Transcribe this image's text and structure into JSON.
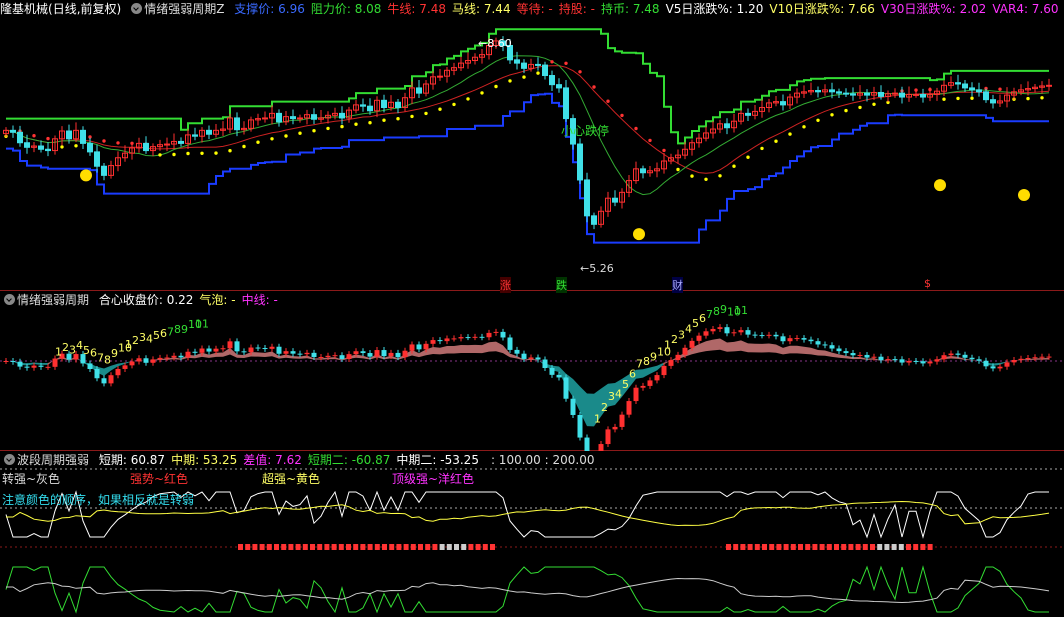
{
  "colors": {
    "bg": "#000000",
    "up": "#ff3030",
    "down": "#40e0e8",
    "green": "#33dd33",
    "blue": "#1a3cff",
    "yellow": "#ffff00",
    "magenta": "#ff33ff",
    "white": "#ffffff",
    "red": "#ff3333",
    "label_gray": "#dddddd",
    "teal": "#1a8a8a",
    "rose": "#b06868"
  },
  "panel1": {
    "stock_name": "隆基机械",
    "period": "(日线,前复权)",
    "indicator": "情绪强弱周期Z",
    "values": [
      {
        "label": "支撑价",
        "value": "6.96",
        "color": "#3a6aff"
      },
      {
        "label": "阻力价",
        "value": "8.08",
        "color": "#33dd33"
      },
      {
        "label": "牛线",
        "value": "7.48",
        "color": "#ff3333"
      },
      {
        "label": "马线",
        "value": "7.44",
        "color": "#ffff66"
      },
      {
        "label": "等待",
        "value": "-",
        "color": "#ff3333"
      },
      {
        "label": "持股",
        "value": "-",
        "color": "#ff3333"
      },
      {
        "label": "持币",
        "value": "7.48",
        "color": "#33dd33"
      },
      {
        "label": "V5日涨跌%",
        "value": "1.20",
        "color": "#ffffff"
      },
      {
        "label": "V10日涨跌%",
        "value": "7.66",
        "color": "#ffff66"
      },
      {
        "label": "V30日涨跌%",
        "value": "2.02",
        "color": "#ff33ff"
      },
      {
        "label": "VAR4",
        "value": "7.60",
        "color": "#ff33ff"
      }
    ],
    "high_label": "8.60",
    "low_label": "5.26",
    "annotation": "小心跌停",
    "markers": [
      "涨",
      "跌",
      "财",
      "$"
    ]
  },
  "panel2": {
    "indicator": "情绪强弱周期",
    "values": [
      {
        "label": "合心收盘价",
        "value": "0.22",
        "color": "#ffffff"
      },
      {
        "label": "气泡",
        "value": "-",
        "color": "#ffff66"
      },
      {
        "label": "中线",
        "value": "-",
        "color": "#ff33ff"
      }
    ],
    "count_seq": [
      "1",
      "2",
      "3",
      "4",
      "5",
      "6",
      "7",
      "8",
      "9",
      "10",
      "1",
      "2",
      "3",
      "4",
      "5",
      "6",
      "7",
      "8",
      "9",
      "10",
      "11"
    ]
  },
  "panel3": {
    "indicator": "波段周期强弱",
    "values": [
      {
        "label": "短期",
        "value": "60.87",
        "color": "#ffffff"
      },
      {
        "label": "中期",
        "value": "53.25",
        "color": "#ffff66"
      },
      {
        "label": "差值",
        "value": "7.62",
        "color": "#ff33ff"
      },
      {
        "label": "短期二",
        "value": "-60.87",
        "color": "#33dd33"
      },
      {
        "label": "中期二",
        "value": "-53.25",
        "color": "#ffffff"
      }
    ],
    "tail_values": ": 100.00 : 200.00",
    "legend": [
      {
        "text": "转强~灰色",
        "color": "#dddddd"
      },
      {
        "text": "强势~红色",
        "color": "#ff3333"
      },
      {
        "text": "超强~黄色",
        "color": "#ffff66"
      },
      {
        "text": "顶级强~洋红色",
        "color": "#ff33ff"
      }
    ],
    "note": "注意颜色的顺序，如果相反就是转弱",
    "note_color": "#33ddee"
  },
  "chart_data": [
    {
      "type": "candlestick",
      "panel": "price",
      "ylim": [
        5.0,
        8.8
      ],
      "x": [
        0,
        1,
        2,
        3,
        4,
        5,
        6,
        7,
        8,
        9,
        10,
        11,
        12,
        13,
        14,
        15,
        16,
        17,
        18,
        19,
        20,
        21,
        22,
        23,
        24,
        25,
        26,
        27,
        28,
        29,
        30,
        31,
        32,
        33,
        34,
        35,
        36,
        37,
        38,
        39,
        40,
        41,
        42,
        43,
        44,
        45,
        46,
        47,
        48,
        49,
        50,
        51,
        52,
        53,
        54,
        55,
        56,
        57,
        58,
        59,
        60,
        61,
        62,
        63,
        64,
        65,
        66,
        67,
        68,
        69,
        70,
        71,
        72,
        73,
        74,
        75,
        76,
        77,
        78,
        79,
        80,
        81,
        82,
        83,
        84,
        85,
        86,
        87,
        88,
        89,
        90,
        91,
        92,
        93,
        94,
        95,
        96,
        97,
        98,
        99,
        100,
        101,
        102,
        103,
        104,
        105,
        106,
        107,
        108,
        109,
        110,
        111,
        112,
        113,
        114,
        115,
        116,
        117,
        118,
        119,
        120,
        121,
        122,
        123,
        124,
        125,
        126,
        127,
        128,
        129,
        130,
        131,
        132,
        133,
        134,
        135,
        136,
        137,
        138,
        139,
        140,
        141,
        142,
        143,
        144,
        145,
        146,
        147,
        148,
        149
      ],
      "close": [
        7.14,
        7.11,
        6.95,
        6.88,
        6.9,
        6.85,
        6.83,
        7.01,
        7.13,
        7.01,
        7.14,
        6.94,
        6.81,
        6.59,
        6.45,
        6.6,
        6.72,
        6.79,
        6.87,
        6.94,
        6.83,
        6.89,
        6.92,
        6.93,
        6.97,
        6.94,
        7.07,
        7.05,
        7.14,
        7.08,
        7.14,
        7.16,
        7.33,
        7.15,
        7.17,
        7.3,
        7.32,
        7.33,
        7.4,
        7.27,
        7.35,
        7.32,
        7.33,
        7.38,
        7.31,
        7.33,
        7.37,
        7.4,
        7.33,
        7.45,
        7.53,
        7.51,
        7.44,
        7.6,
        7.49,
        7.57,
        7.49,
        7.64,
        7.79,
        7.71,
        7.85,
        7.96,
        7.97,
        8.06,
        8.1,
        8.17,
        8.21,
        8.26,
        8.3,
        8.44,
        8.51,
        8.44,
        8.22,
        8.17,
        8.09,
        8.15,
        8.14,
        7.98,
        7.84,
        7.79,
        7.32,
        6.93,
        6.38,
        5.83,
        5.7,
        5.9,
        6.1,
        6.04,
        6.19,
        6.37,
        6.55,
        6.49,
        6.52,
        6.55,
        6.67,
        6.72,
        6.76,
        6.85,
        6.95,
        7.02,
        7.1,
        7.16,
        7.24,
        7.18,
        7.28,
        7.4,
        7.37,
        7.43,
        7.49,
        7.56,
        7.58,
        7.53,
        7.65,
        7.71,
        7.73,
        7.75,
        7.73,
        7.76,
        7.73,
        7.71,
        7.7,
        7.68,
        7.71,
        7.68,
        7.72,
        7.66,
        7.7,
        7.71,
        7.65,
        7.69,
        7.69,
        7.65,
        7.69,
        7.74,
        7.83,
        7.87,
        7.85,
        7.79,
        7.76,
        7.73,
        7.61,
        7.56,
        7.59,
        7.68,
        7.73,
        7.76,
        7.78,
        7.8,
        7.82,
        7.83
      ]
    },
    {
      "type": "line",
      "panel": "price",
      "series": [
        {
          "name": "阻力价",
          "values_start": 8.08,
          "values_peak": 8.6
        },
        {
          "name": "支撑价",
          "values_start": 6.96,
          "values_low": 5.26
        }
      ]
    },
    {
      "type": "line",
      "panel": "wave",
      "ylim": [
        -100,
        100
      ],
      "series": [
        {
          "name": "短期",
          "last": 60.87
        },
        {
          "name": "中期",
          "last": 53.25
        },
        {
          "name": "短期二",
          "last": -60.87
        },
        {
          "name": "中期二",
          "last": -53.25
        }
      ],
      "ref_lines": [
        100,
        200
      ]
    }
  ]
}
